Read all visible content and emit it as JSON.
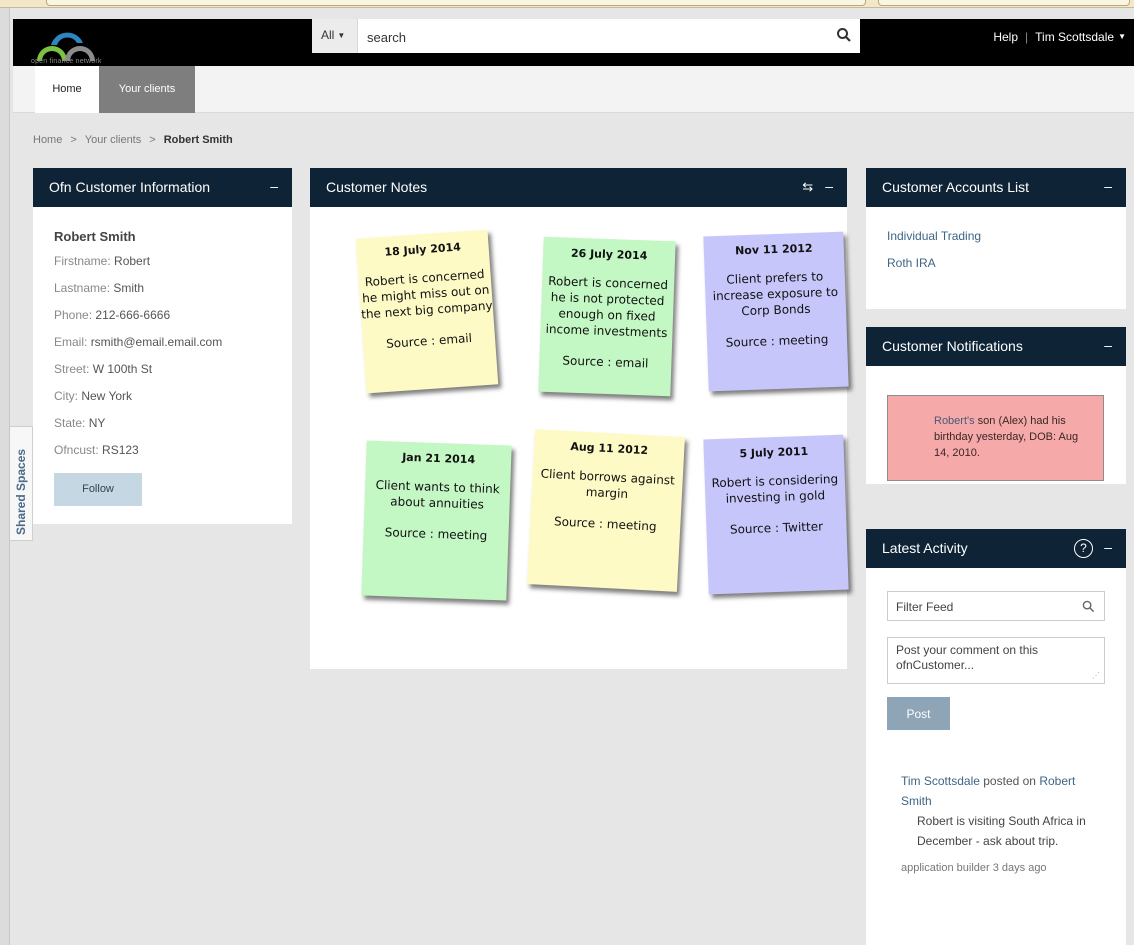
{
  "header": {
    "logo_text": "open finance network",
    "search_scope": "All",
    "search_placeholder": "search",
    "help_label": "Help",
    "user_name": "Tim Scottsdale"
  },
  "nav": {
    "tabs": [
      {
        "label": "Home"
      },
      {
        "label": "Your clients"
      }
    ]
  },
  "breadcrumb": {
    "items": [
      "Home",
      "Your clients"
    ],
    "current": "Robert Smith"
  },
  "shared_spaces": "Shared Spaces",
  "customer_info": {
    "title": "Ofn Customer Information",
    "name": "Robert Smith",
    "fields": [
      {
        "label": "Firstname:",
        "value": "Robert"
      },
      {
        "label": "Lastname:",
        "value": "Smith"
      },
      {
        "label": "Phone:",
        "value": "212-666-6666"
      },
      {
        "label": "Email:",
        "value": "rsmith@email.email.com"
      },
      {
        "label": "Street:",
        "value": "W 100th St"
      },
      {
        "label": "City:",
        "value": "New York"
      },
      {
        "label": "State:",
        "value": "NY"
      },
      {
        "label": "Ofncust:",
        "value": "RS123"
      }
    ],
    "follow_label": "Follow"
  },
  "customer_notes": {
    "title": "Customer Notes",
    "notes": [
      {
        "date": "18 July 2014",
        "text": "Robert is concerned he might miss out on the next big company",
        "source": "Source : email",
        "color": "#fefac5"
      },
      {
        "date": "26 July 2014",
        "text": "Robert is concerned he is not protected enough on fixed income investments",
        "source": "Source : email",
        "color": "#c3f7c3"
      },
      {
        "date": "Nov 11 2012",
        "text": "Client prefers to increase exposure to Corp Bonds",
        "source": "Source : meeting",
        "color": "#c7c6fb"
      },
      {
        "date": "Jan 21 2014",
        "text": "Client wants to think about annuities",
        "source": "Source : meeting",
        "color": "#c3f7c3"
      },
      {
        "date": "Aug 11 2012",
        "text": "Client borrows against margin",
        "source": "Source : meeting",
        "color": "#fefac5"
      },
      {
        "date": "5 July 2011",
        "text": "Robert is considering investing in gold",
        "source": "Source : Twitter",
        "color": "#c7c6fb"
      }
    ]
  },
  "accounts": {
    "title": "Customer Accounts List",
    "items": [
      "Individual Trading",
      "Roth IRA"
    ]
  },
  "notifications": {
    "title": "Customer Notifications",
    "name_part": "Robert's",
    "text": " son (Alex) had his birthday yesterday, DOB: Aug 14, 2010."
  },
  "activity": {
    "title": "Latest Activity",
    "filter_placeholder": "Filter Feed",
    "comment_placeholder": "Post your comment on this ofnCustomer...",
    "post_label": "Post",
    "entry": {
      "author": "Tim Scottsdale",
      "verb": " posted on ",
      "target": "Robert Smith",
      "body": "Robert is visiting South Africa in December - ask about trip.",
      "source": "application builder",
      "time": "3 days ago"
    }
  },
  "colors": {
    "header_bg": "#000000",
    "panel_header_bg": "#0e2336",
    "link": "#3e6585",
    "active_tab": "#7e7e7e",
    "notification_bg": "#f5a9a9"
  }
}
